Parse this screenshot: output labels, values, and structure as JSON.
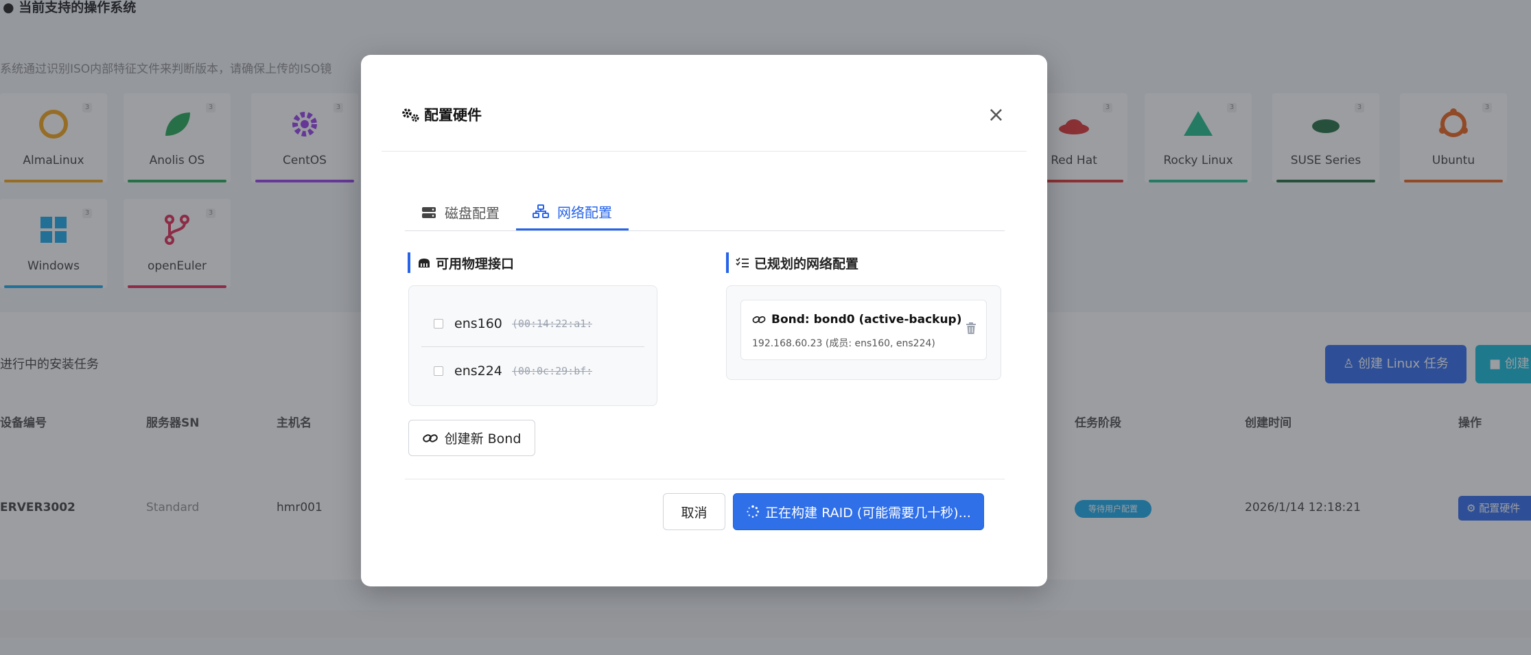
{
  "background": {
    "title": "当前支持的操作系统",
    "hint": "系统通过识别ISO内部特征文件来判断版本，请确保上传的ISO镜",
    "os_cards": [
      {
        "name": "AlmaLinux",
        "badge": "3",
        "color": "#f59e0b"
      },
      {
        "name": "Anolis OS",
        "badge": "3",
        "color": "#16a34a"
      },
      {
        "name": "CentOS",
        "badge": "3",
        "color": "#9333ea"
      },
      {
        "name": "Red Hat",
        "badge": "3",
        "color": "#dc2626"
      },
      {
        "name": "Rocky Linux",
        "badge": "3",
        "color": "#10b981"
      },
      {
        "name": "SUSE Series",
        "badge": "3",
        "color": "#166534"
      },
      {
        "name": "Ubuntu",
        "badge": "3",
        "color": "#ea580c"
      },
      {
        "name": "Windows",
        "badge": "3",
        "color": "#0ea5e9"
      },
      {
        "name": "openEuler",
        "badge": "3",
        "color": "#e11d48"
      }
    ],
    "tasks_title": "进行中的安装任务",
    "create_linux_btn": "创建 Linux 任务",
    "create_other_btn": "创建",
    "table_headers": [
      "设备编号",
      "服务器SN",
      "主机名",
      "任务阶段",
      "创建时间",
      "操作"
    ],
    "row": {
      "device": "ERVER3002",
      "sn": "Standard",
      "host": "hmr001",
      "stage": "等待用户配置",
      "time": "2026/1/14 12:18:21",
      "action": "配置硬件"
    }
  },
  "modal": {
    "title": "配置硬件",
    "close": "×",
    "tabs": [
      {
        "label": "磁盘配置",
        "active": false
      },
      {
        "label": "网络配置",
        "active": true
      }
    ],
    "available_title": "可用物理接口",
    "interfaces": [
      {
        "name": "ens160",
        "mac": "(00:14:22:a1:"
      },
      {
        "name": "ens224",
        "mac": "(00:0c:29:bf:"
      }
    ],
    "create_bond_label": "创建新 Bond",
    "planned_title": "已规划的网络配置",
    "bond": {
      "title": "Bond: bond0 (active-backup)",
      "detail": "192.168.60.23 (成员: ens160, ens224)"
    },
    "cancel_label": "取消",
    "submit_label": "正在构建 RAID (可能需要几十秒)..."
  },
  "colors": {
    "accent": "#2563eb",
    "overlay": "rgba(55,60,68,0.5)"
  }
}
